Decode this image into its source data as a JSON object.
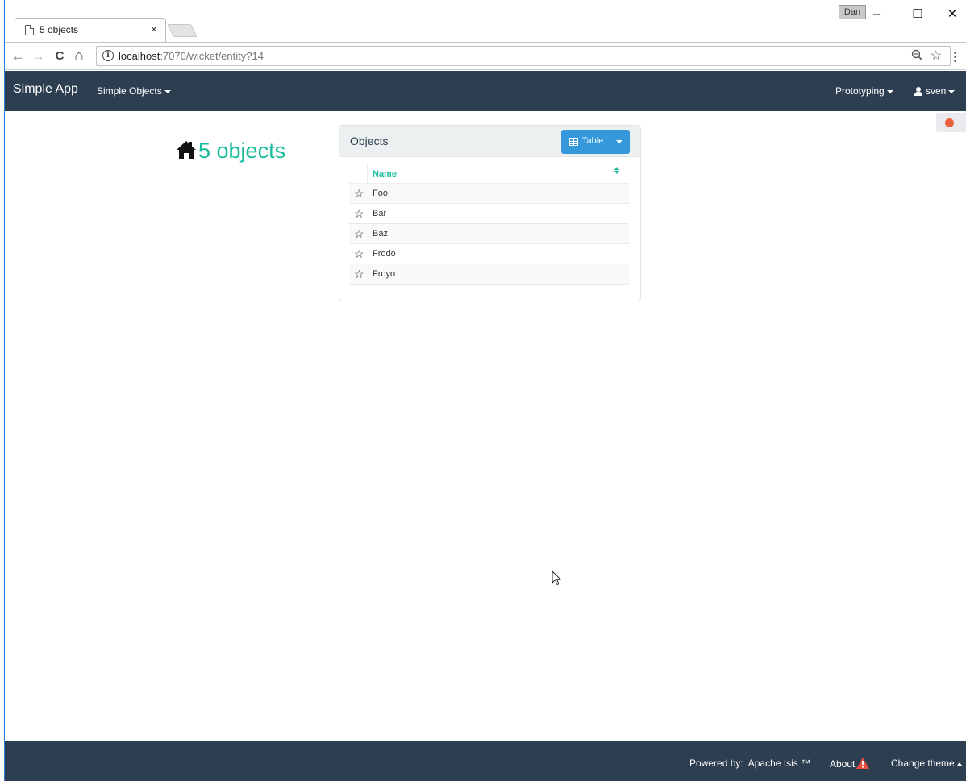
{
  "browser": {
    "tab_title": "5 objects",
    "tab_close": "×",
    "user_badge": "Dan",
    "minimize": "–",
    "maximize": "☐",
    "close": "✕",
    "back": "←",
    "forward": "→",
    "reload": "C",
    "home": "⌂",
    "url_host": "localhost",
    "url_path": ":7070/wicket/entity?14",
    "zoom_icon": "magnifier",
    "menu_icon": "⋮"
  },
  "navbar": {
    "brand": "Simple App",
    "menu_simple_objects": "Simple Objects",
    "menu_prototyping": "Prototyping",
    "menu_user": "sven"
  },
  "page": {
    "title": "5 objects"
  },
  "panel": {
    "title": "Objects",
    "view_button_label": "Table",
    "column_name": "Name",
    "rows": [
      "Foo",
      "Bar",
      "Baz",
      "Frodo",
      "Froyo"
    ]
  },
  "footer": {
    "powered_by": "Powered by:",
    "powered_link": "Apache Isis ™",
    "about": "About",
    "change_theme": "Change theme"
  },
  "colors": {
    "navbar": "#2c3e50",
    "accent": "#18bc9c",
    "button": "#3498db",
    "warning": "#e74c3c"
  }
}
